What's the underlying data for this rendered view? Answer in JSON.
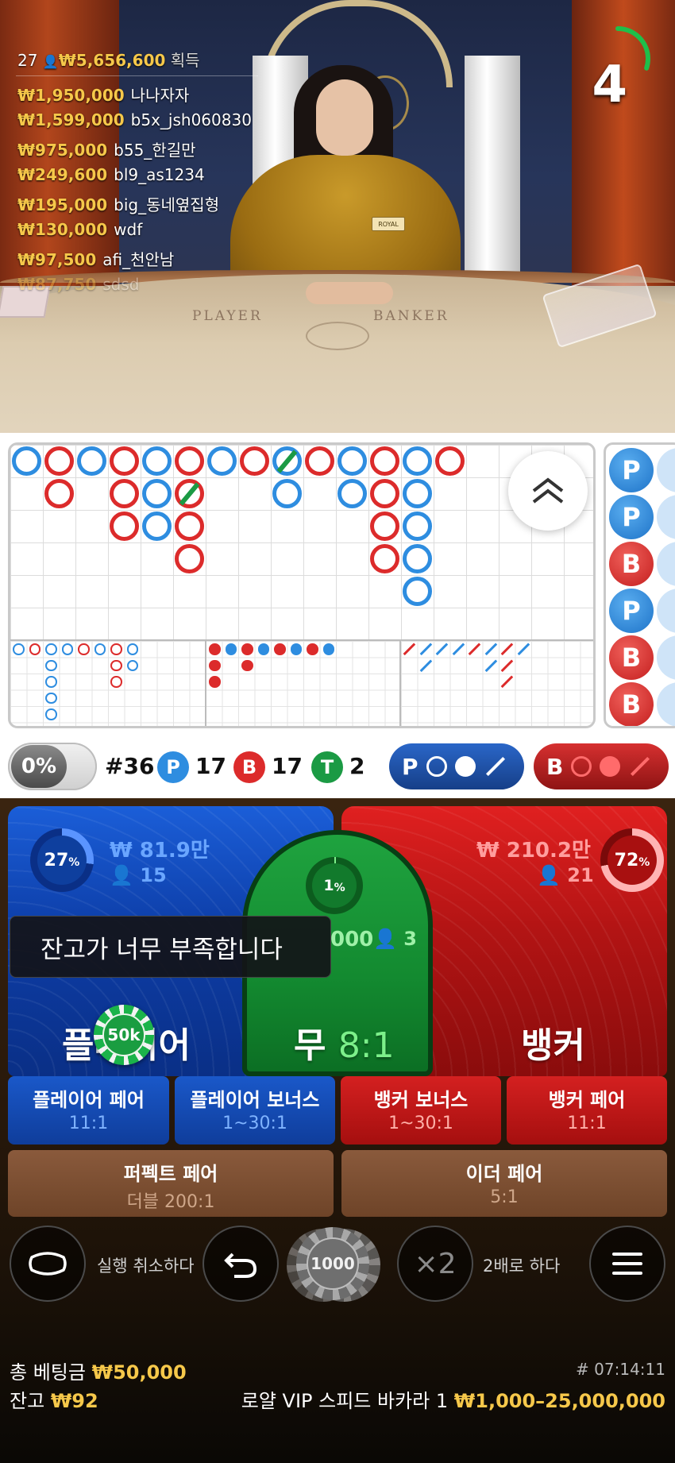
{
  "winners": {
    "count": "27",
    "total": "₩5,656,600",
    "label": "획득",
    "rows": [
      {
        "amount": "₩1,950,000",
        "name": "나나자자"
      },
      {
        "amount": "₩1,599,000",
        "name": "b5x_jsh060830"
      },
      {
        "amount": "₩975,000",
        "name": "b55_한길만"
      },
      {
        "amount": "₩249,600",
        "name": "bl9_as1234"
      },
      {
        "amount": "₩195,000",
        "name": "big_동네옆집형"
      },
      {
        "amount": "₩130,000",
        "name": "wdf"
      },
      {
        "amount": "₩97,500",
        "name": "afi_천안남"
      },
      {
        "amount": "₩87,750",
        "name": "sdsd"
      }
    ]
  },
  "table_labels": {
    "player": "PLAYER",
    "banker": "BANKER",
    "badge": "ROYAL"
  },
  "countdown": {
    "value": "4",
    "remaining_fraction": 0.3,
    "color": "#1fbf4a"
  },
  "bead_road": [
    "P",
    "P",
    "B",
    "P",
    "B",
    "B"
  ],
  "stats": {
    "percent": "0%",
    "round": "#36",
    "player_label": "P",
    "player_count": "17",
    "banker_label": "B",
    "banker_count": "17",
    "tie_label": "T",
    "tie_count": "2"
  },
  "predict": {
    "player": "P",
    "banker": "B"
  },
  "bets": {
    "player": {
      "percent": "27",
      "pct_sign": "%",
      "amount": "₩ 81.9만",
      "players": "15",
      "title": "플레이어",
      "color": "#1b5ed8"
    },
    "tie": {
      "percent": "1",
      "pct_sign": "%",
      "amount": "000",
      "players": "3",
      "title": "무",
      "odds": "8:1",
      "color": "#1fa33f"
    },
    "banker": {
      "percent": "72",
      "pct_sign": "%",
      "amount": "₩ 210.2만",
      "players": "21",
      "title": "뱅커",
      "color": "#e02020"
    }
  },
  "toast": "잔고가 너무 부족합니다",
  "placed_chip": "50k",
  "side_bets": [
    {
      "title": "플레이어 페어",
      "odds": "11:1"
    },
    {
      "title": "플레이어 보너스",
      "odds": "1~30:1"
    },
    {
      "title": "뱅커 보너스",
      "odds": "1~30:1"
    },
    {
      "title": "뱅커 페어",
      "odds": "11:1"
    },
    {
      "title": "퍼펙트 페어",
      "odds": "더블 200:1"
    },
    {
      "title": "이더 페어",
      "odds": "5:1"
    }
  ],
  "controls": {
    "undo_label": "실행 취소하다",
    "chip_value": "1000",
    "double_icon": "×2",
    "double_label": "2배로 하다"
  },
  "footer": {
    "total_bet_label": "총 베팅금",
    "total_bet": "₩50,000",
    "balance_label": "잔고",
    "balance": "₩92",
    "game_id": "# 07:14:11",
    "table_name": "로얄 VIP 스피드 바카라 1",
    "limits": "₩1,000–25,000,000"
  }
}
